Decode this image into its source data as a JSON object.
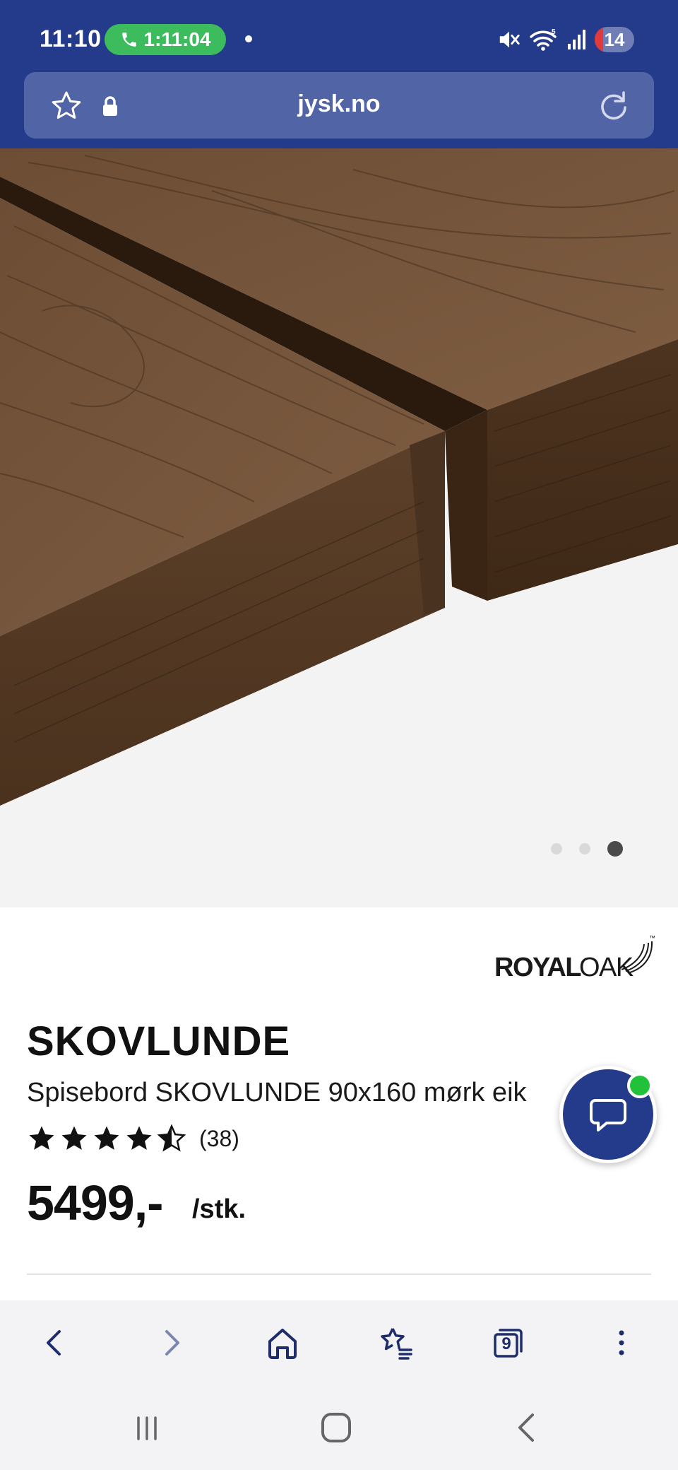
{
  "status_bar": {
    "time": "11:10",
    "call_timer": "1:11:04",
    "battery": "14"
  },
  "browser": {
    "url": "jysk.no",
    "tabs_count": "9"
  },
  "gallery": {
    "slide_count": 3,
    "active_slide": 3
  },
  "product": {
    "brand_logo": {
      "part1": "ROYAL",
      "part2": "OAK",
      "tm": "™"
    },
    "name": "SKOVLUNDE",
    "description": "Spisebord SKOVLUNDE 90x160 mørk eik",
    "rating": {
      "stars": 4.5,
      "count": "(38)"
    },
    "price": "5499,-",
    "unit": "/stk."
  },
  "colors": {
    "brand_blue": "#243a8a",
    "url_bar": "#5164a6",
    "call_green": "#3cbc5c",
    "online_green": "#22c13a",
    "nav_icon": "#1e2d6b"
  }
}
